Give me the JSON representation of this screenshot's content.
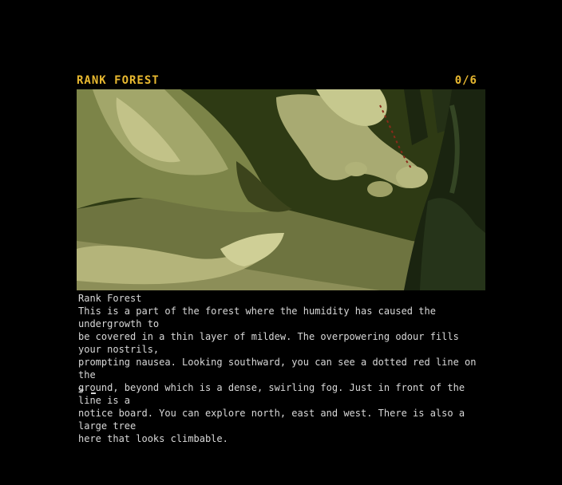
{
  "header": {
    "location": "RANK FOREST",
    "score": "0/6"
  },
  "room": {
    "title": "Rank Forest",
    "description": "This is a part of the forest where the humidity has caused the undergrowth to\nbe covered in a thin layer of mildew. The overpowering odour fills your nostrils,\nprompting nausea. Looking southward, you can see a dotted red line on the\nground, beyond which is a dense, swirling fog. Just in front of the line is a\nnotice board. You can explore north, east and west. There is also a large tree\nhere that looks climbable."
  },
  "prompt": {
    "symbol": ">"
  },
  "colors": {
    "heading": "#e8b830",
    "text": "#d8d8d8",
    "background": "#000000"
  }
}
